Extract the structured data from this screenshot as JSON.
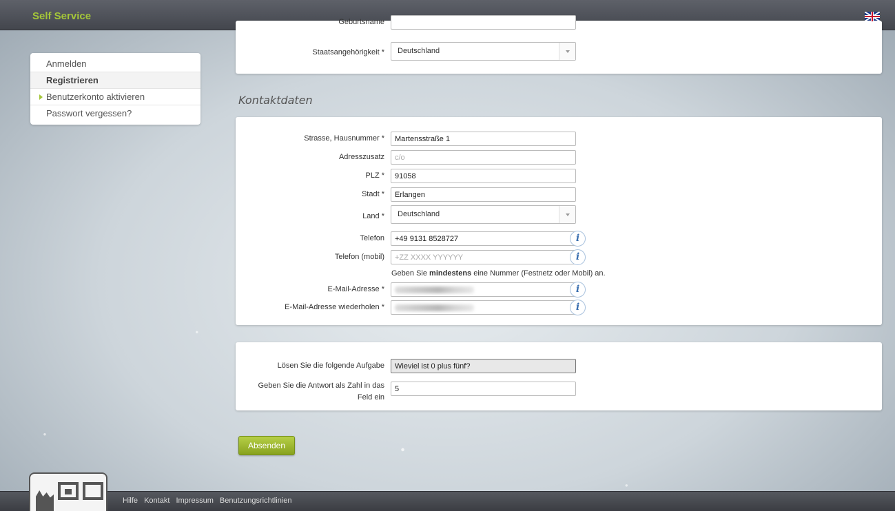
{
  "header": {
    "brand": "Self Service",
    "language_flag": "uk-flag-icon"
  },
  "sidebar": {
    "items": [
      {
        "label": "Anmelden"
      },
      {
        "label": "Registrieren"
      },
      {
        "label": "Benutzerkonto aktivieren"
      },
      {
        "label": "Passwort vergessen?"
      }
    ]
  },
  "personal": {
    "geburtsname_label": "Geburtsname",
    "nationality_label": "Staatsangehörigkeit *",
    "nationality_value": "Deutschland"
  },
  "contact": {
    "title": "Kontaktdaten",
    "street_label": "Strasse, Hausnummer *",
    "street_value": "Martensstraße 1",
    "address2_label": "Adresszusatz",
    "address2_placeholder": "c/o",
    "zip_label": "PLZ *",
    "zip_value": "91058",
    "city_label": "Stadt *",
    "city_value": "Erlangen",
    "country_label": "Land *",
    "country_value": "Deutschland",
    "phone_label": "Telefon",
    "phone_value": "+49 9131 8528727",
    "mobile_label": "Telefon (mobil)",
    "mobile_placeholder": "+ZZ XXXX YYYYYY",
    "hint_pre": "Geben Sie ",
    "hint_bold": "mindestens",
    "hint_post": " eine Nummer (Festnetz oder Mobil) an.",
    "email_label": "E-Mail-Adresse *",
    "email_repeat_label": "E-Mail-Adresse wiederholen *",
    "info_glyph": "i"
  },
  "captcha": {
    "task_label": "Lösen Sie die folgende Aufgabe",
    "task_value": "Wieviel ist 0 plus fünf?",
    "answer_label": "Geben Sie die Antwort als Zahl in das Feld ein",
    "answer_value": "5"
  },
  "actions": {
    "submit_label": "Absenden"
  },
  "footer": {
    "links": [
      "Hilfe",
      "Kontakt",
      "Impressum",
      "Benutzungsrichtlinien"
    ]
  },
  "colors": {
    "accent": "#a4c639",
    "header_bg": "#4f5259",
    "info_blue": "#3a6fb0"
  }
}
